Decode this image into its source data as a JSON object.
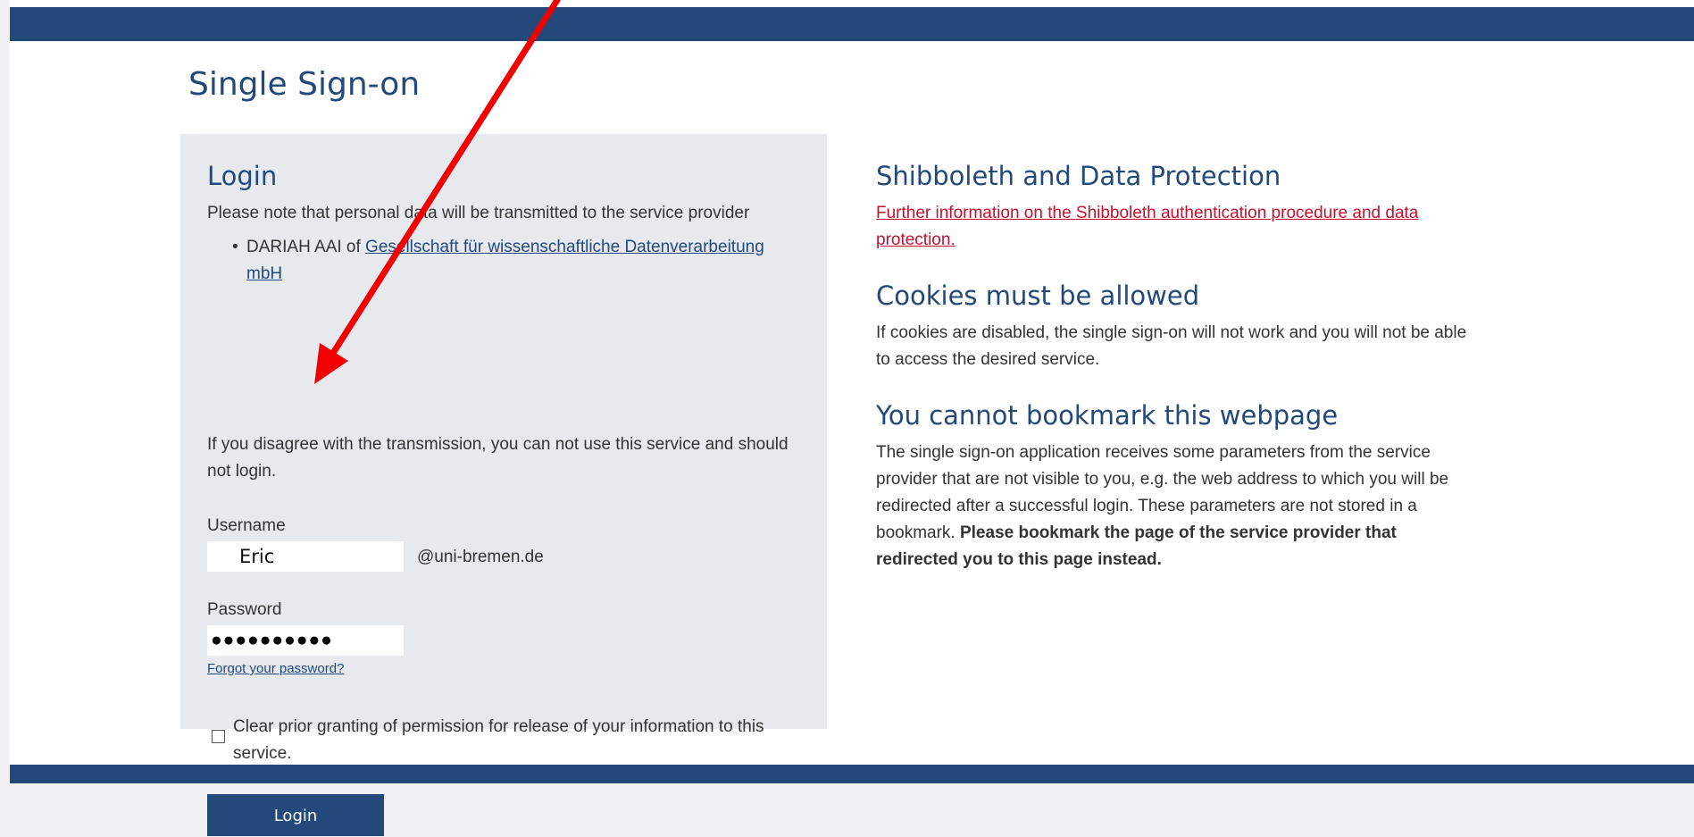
{
  "page": {
    "title": "Single Sign-on"
  },
  "login": {
    "heading": "Login",
    "note": "Please note that personal data will be transmitted to the service provider",
    "provider_prefix": "DARIAH AAI of ",
    "provider_link": "Gesellschaft für wissenschaftliche Datenverarbeitung mbH",
    "disagree_text": "If you disagree with the transmission, you can not use this service and should not login.",
    "username_label": "Username",
    "username_value": "Eric",
    "domain_suffix": "@uni-bremen.de",
    "password_label": "Password",
    "password_masked": "●●●●●●●●●●",
    "forgot_link": "Forgot your password?",
    "clear_permission_text": "Clear prior granting of permission for release of your information to this service.",
    "clear_permission_checked": false,
    "login_button": "Login"
  },
  "info": {
    "shibboleth_heading": "Shibboleth and Data Protection",
    "shibboleth_link": "Further information on the Shibboleth authentication procedure and data protection.",
    "cookies_heading": "Cookies must be allowed",
    "cookies_text": "If cookies are disabled, the single sign-on will not work and you will not be able to access the desired service.",
    "bookmark_heading": "You cannot bookmark this webpage",
    "bookmark_text": "The single sign-on application receives some parameters from the service provider that are not visible to you, e.g. the web address to which you will be redirected after a successful login. These parameters are not stored in a bookmark. ",
    "bookmark_bold": "Please bookmark the page of the service provider that redirected you to this page instead."
  },
  "colors": {
    "brand_blue": "#23497b",
    "panel_gray": "#e6e9ee",
    "link_red": "#c8102e",
    "annotation_arrow": "#f20000"
  },
  "icons": {
    "annotation": "red-arrow-pointing-to-username"
  }
}
